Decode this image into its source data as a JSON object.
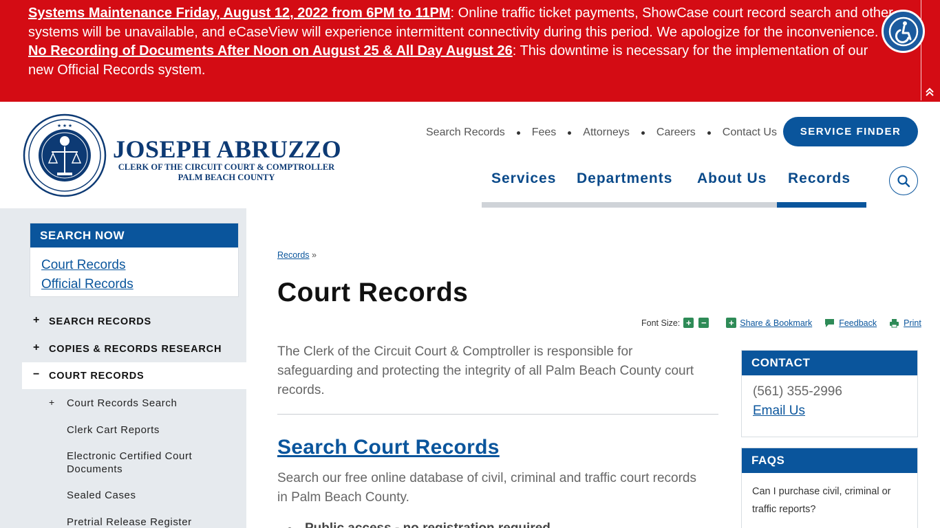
{
  "alert": {
    "line1_link": "Systems Maintenance Friday, August 12, 2022 from 6PM to 11PM",
    "line1_text": ": Online traffic ticket payments, ShowCase court record search and other systems will be unavailable, and eCaseView will experience intermittent connectivity during this period. We apologize for the inconvenience.",
    "line2_link": "No Recording of Documents After Noon on August 25 & All Day August 26",
    "line2_text": ": This downtime is necessary for the implementation of our new Official Records system."
  },
  "logo": {
    "name": "JOSEPH ABRUZZO",
    "line1": "CLERK OF THE CIRCUIT COURT & COMPTROLLER",
    "line2": "PALM BEACH COUNTY"
  },
  "utility_nav": [
    "Search Records",
    "Fees",
    "Attorneys",
    "Careers",
    "Contact Us"
  ],
  "service_finder": "SERVICE FINDER",
  "main_nav": [
    "Services",
    "Departments",
    "About Us",
    "Records"
  ],
  "sidebar": {
    "search_now_title": "SEARCH NOW",
    "search_now_links": [
      "Court Records",
      "Official Records"
    ],
    "items": [
      {
        "sign": "+",
        "label": "SEARCH RECORDS"
      },
      {
        "sign": "+",
        "label": "COPIES & RECORDS RESEARCH"
      },
      {
        "sign": "−",
        "label": "COURT RECORDS"
      }
    ],
    "sub_items": [
      {
        "sign": "+",
        "label": "Court Records Search"
      },
      {
        "sign": "",
        "label": "Clerk Cart Reports"
      },
      {
        "sign": "",
        "label": "Electronic Certified Court Documents"
      },
      {
        "sign": "",
        "label": "Sealed Cases"
      },
      {
        "sign": "",
        "label": "Pretrial Release Register"
      }
    ]
  },
  "breadcrumb": {
    "link": "Records",
    "sep": "»"
  },
  "page_title": "Court Records",
  "toolbar": {
    "font_size_label": "Font Size:",
    "increase": "+",
    "decrease": "−",
    "share": "Share & Bookmark",
    "feedback": "Feedback",
    "print": "Print"
  },
  "content": {
    "intro": "The Clerk of the Circuit Court & Comptroller is responsible for safeguarding and protecting the integrity of all Palm Beach County court records.",
    "section_title": "Search Court Records",
    "section_text": "Search our free online database of civil, criminal and traffic court records in Palm Beach County.",
    "cut_text": "Public access - no registration required"
  },
  "contact": {
    "title": "CONTACT",
    "phone": "(561) 355-2996",
    "email": "Email Us"
  },
  "faqs": {
    "title": "FAQS",
    "question": "Can I purchase civil, criminal or traffic reports?"
  },
  "colors": {
    "alert_red": "#d40c14",
    "brand_blue": "#0a559c",
    "navy": "#0d3a74"
  }
}
